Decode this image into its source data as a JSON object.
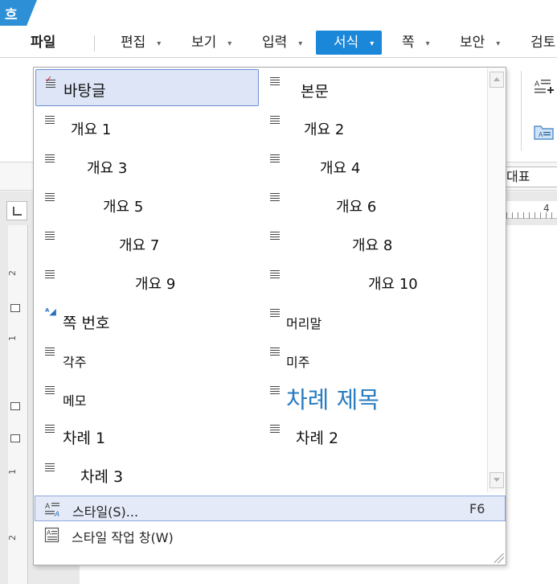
{
  "app": {
    "logo_glyph": "흐"
  },
  "menubar": {
    "items": [
      {
        "label": "파일",
        "has_arrow": false
      },
      {
        "label": "편집",
        "has_arrow": true
      },
      {
        "label": "보기",
        "has_arrow": true
      },
      {
        "label": "입력",
        "has_arrow": true
      },
      {
        "label": "서식",
        "has_arrow": true,
        "active": true
      },
      {
        "label": "쪽",
        "has_arrow": true
      },
      {
        "label": "보안",
        "has_arrow": true
      },
      {
        "label": "검토",
        "has_arrow": false
      }
    ],
    "arrow_glyph": "▾"
  },
  "toolbar": {
    "style_combo_value": "대표"
  },
  "ruler": {
    "horizontal_number": "4",
    "vertical_numbers": [
      "2",
      "1",
      "1",
      "2"
    ]
  },
  "style_menu": {
    "styles": [
      {
        "label": "바탕글",
        "selected": true
      },
      {
        "label": "본문"
      },
      {
        "label": "개요 1"
      },
      {
        "label": "개요 2"
      },
      {
        "label": "개요 3"
      },
      {
        "label": "개요 4"
      },
      {
        "label": "개요 5"
      },
      {
        "label": "개요 6"
      },
      {
        "label": "개요 7"
      },
      {
        "label": "개요 8"
      },
      {
        "label": "개요 9"
      },
      {
        "label": "개요 10"
      },
      {
        "label": "쪽 번호",
        "icon": "character-style-icon"
      },
      {
        "label": "머리말"
      },
      {
        "label": "각주"
      },
      {
        "label": "미주"
      },
      {
        "label": "메모"
      },
      {
        "label": "차례 제목"
      },
      {
        "label": "차례 1"
      },
      {
        "label": "차례 2"
      },
      {
        "label": "차례 3"
      }
    ],
    "actions": [
      {
        "label": "스타일(S)...",
        "shortcut": "F6",
        "highlighted": true
      },
      {
        "label": "스타일 작업 창(W)",
        "shortcut": ""
      }
    ]
  },
  "colors": {
    "accent": "#1b87d9",
    "selection_bg": "#dde5f6",
    "toc_title": "#2a7cc0"
  }
}
